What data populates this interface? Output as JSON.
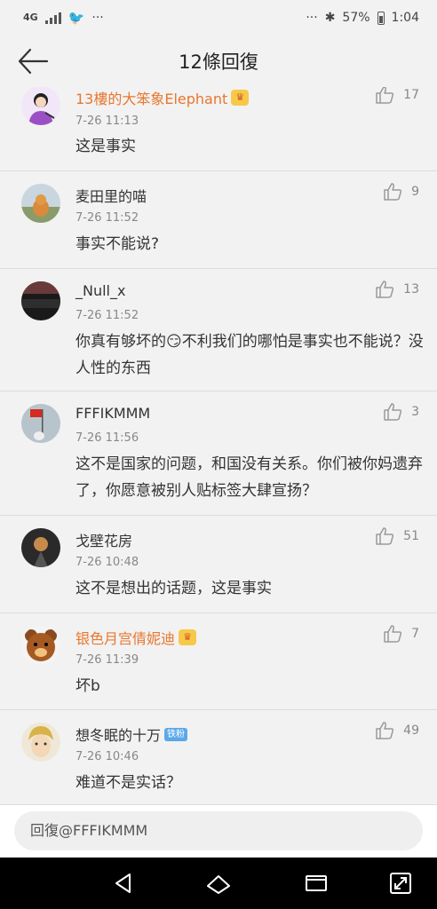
{
  "status": {
    "network": "4G",
    "battery": "57%",
    "time": "1:04",
    "dots": "···"
  },
  "nav": {
    "title": "12條回復"
  },
  "comments": [
    {
      "user": "13樓的大笨象Elephant",
      "time": "7-26 11:13",
      "text": "这是事实",
      "likes": "17"
    },
    {
      "user": "麦田里的喵",
      "time": "7-26 11:52",
      "text": "事实不能说?",
      "likes": "9"
    },
    {
      "user": "_Null_x",
      "time": "7-26 11:52",
      "text": "你真有够坏的😏不利我们的哪怕是事实也不能说？没人性的东西",
      "likes": "13"
    },
    {
      "user": "FFFIKMMM",
      "time": "7-26 11:56",
      "text": "这不是国家的问题，和国没有关系。你们被你妈遗弃了，你愿意被别人贴标签大肆宣扬？",
      "likes": "3"
    },
    {
      "user": "戈壁花房",
      "time": "7-26 10:48",
      "text": "这不是想出的话题，这是事实",
      "likes": "51"
    },
    {
      "user": "银色月宫倩妮迪",
      "time": "7-26 11:39",
      "text": "坏b",
      "likes": "7"
    },
    {
      "user": "想冬眠的十万",
      "badge": "铁粉",
      "time": "7-26 10:46",
      "text": "难道不是实话？",
      "likes": "49"
    }
  ],
  "reply": {
    "placeholder": "回復@FFFIKMMM"
  },
  "colors": {
    "vip_name": "#e8772e",
    "badge": "#5aa8ea",
    "bg": "#f2f2f2"
  }
}
